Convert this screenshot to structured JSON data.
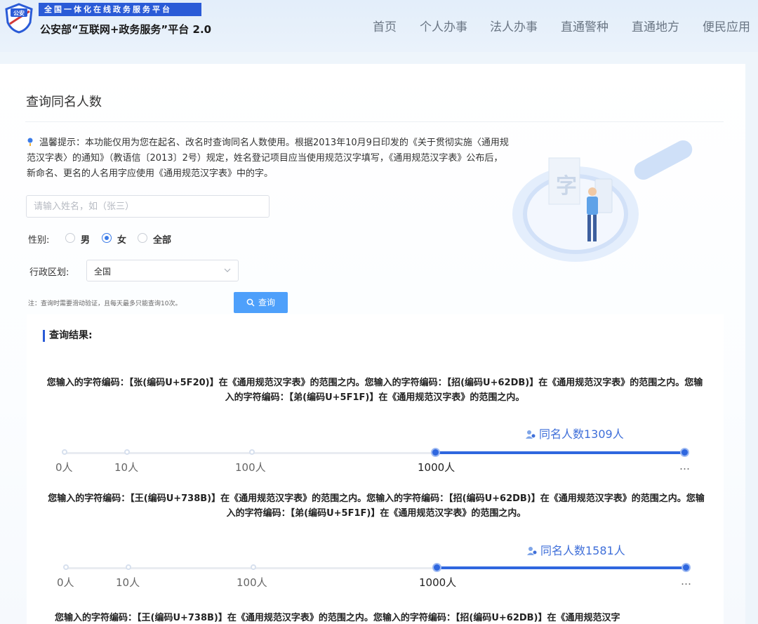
{
  "header": {
    "tagline": "全国一体化在线政务服务平台",
    "site_title": "公安部“互联网+政务服务”平台 2.0",
    "logo_text": "公安",
    "nav": [
      "首页",
      "个人办事",
      "法人办事",
      "直通警种",
      "直通地方",
      "便民应用"
    ]
  },
  "page": {
    "title": "查询同名人数",
    "tip": "温馨提示：本功能仅用为您在起名、改名时查询同名人数使用。根据2013年10月9日印发的《关于贯彻实施〈通用规范汉字表〉的通知》（教语信〔2013〕2号）规定，姓名登记项目应当使用规范汉字填写，《通用规范汉字表》公布后，新命名、更名的人名用字应使用《通用规范汉字表》中的字。"
  },
  "form": {
    "name_placeholder": "请输入姓名，如（张三）",
    "gender_label": "性别:",
    "gender_options": [
      "男",
      "女",
      "全部"
    ],
    "gender_selected": "女",
    "region_label": "行政区划:",
    "region_value": "全国",
    "note": "注：查询时需要滑动验证，且每天最多只能查询10次。",
    "query_button": "查询"
  },
  "results": {
    "title": "查询结果:",
    "scale_labels": [
      "0人",
      "10人",
      "100人",
      "1000人",
      "…"
    ],
    "items": [
      {
        "text": "您输入的字符编码：【张(编码U+5F20)】在《通用规范汉字表》的范围之内。您输入的字符编码：【招(编码U+62DB)】在《通用规范汉字表》的范围之内。您输入的字符编码：【弟(编码U+5F1F)】在《通用规范汉字表》的范围之内。",
        "count_text": "同名人数1309人",
        "count": 1309
      },
      {
        "text": "您输入的字符编码：【王(编码U+738B)】在《通用规范汉字表》的范围之内。您输入的字符编码：【招(编码U+62DB)】在《通用规范汉字表》的范围之内。您输入的字符编码：【弟(编码U+5F1F)】在《通用规范汉字表》的范围之内。",
        "count_text": "同名人数1581人",
        "count": 1581
      },
      {
        "text": "您输入的字符编码：【王(编码U+738B)】在《通用规范汉字表》的范围之内。您输入的字符编码：【招(编码U+62DB)】在《通用规范汉字"
      }
    ]
  },
  "colors": {
    "accent": "#2f67df",
    "button": "#4ea0fb",
    "tag_bar": "#2a5bd7"
  }
}
